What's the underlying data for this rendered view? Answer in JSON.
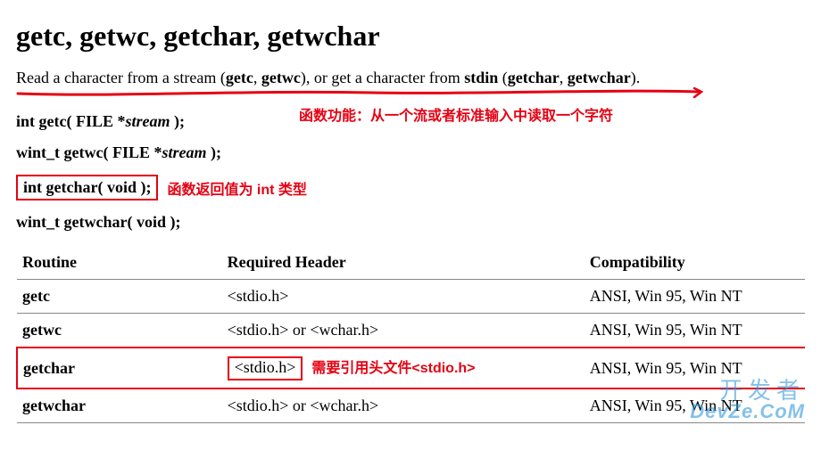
{
  "title": "getc, getwc, getchar, getwchar",
  "summary": {
    "prefix": "Read a character from a stream (",
    "f1": "getc",
    "sep1": ", ",
    "f2": "getwc",
    "mid": "), or get a character from ",
    "stdin": "stdin",
    "sep2": " (",
    "f3": "getchar",
    "sep3": ", ",
    "f4": "getwchar",
    "suffix": ")."
  },
  "annotations": {
    "func_purpose": "函数功能：从一个流或者标准输入中读取一个字符",
    "return_type": "函数返回值为 int 类型",
    "header_note": "需要引用头文件<stdio.h>"
  },
  "declarations": {
    "d1_pre": "int getc( FILE *",
    "d1_arg": "stream",
    "d1_post": " );",
    "d2_pre": "wint_t getwc( FILE *",
    "d2_arg": "stream",
    "d2_post": " );",
    "d3": "int getchar( void );",
    "d4": "wint_t getwchar( void );"
  },
  "table": {
    "headers": {
      "c1": "Routine",
      "c2": "Required Header",
      "c3": "Compatibility"
    },
    "rows": [
      {
        "routine": "getc",
        "header": "<stdio.h>",
        "compat": "ANSI, Win 95, Win NT",
        "highlight": false
      },
      {
        "routine": "getwc",
        "header": "<stdio.h> or <wchar.h>",
        "compat": "ANSI, Win 95, Win NT",
        "highlight": false
      },
      {
        "routine": "getchar",
        "header": "<stdio.h>",
        "compat": "ANSI, Win 95, Win NT",
        "highlight": true
      },
      {
        "routine": "getwchar",
        "header": "<stdio.h> or <wchar.h>",
        "compat": "ANSI, Win 95, Win NT",
        "highlight": false
      }
    ]
  },
  "watermark": {
    "line1": "开发者",
    "line2": "DevZe.CoM"
  }
}
